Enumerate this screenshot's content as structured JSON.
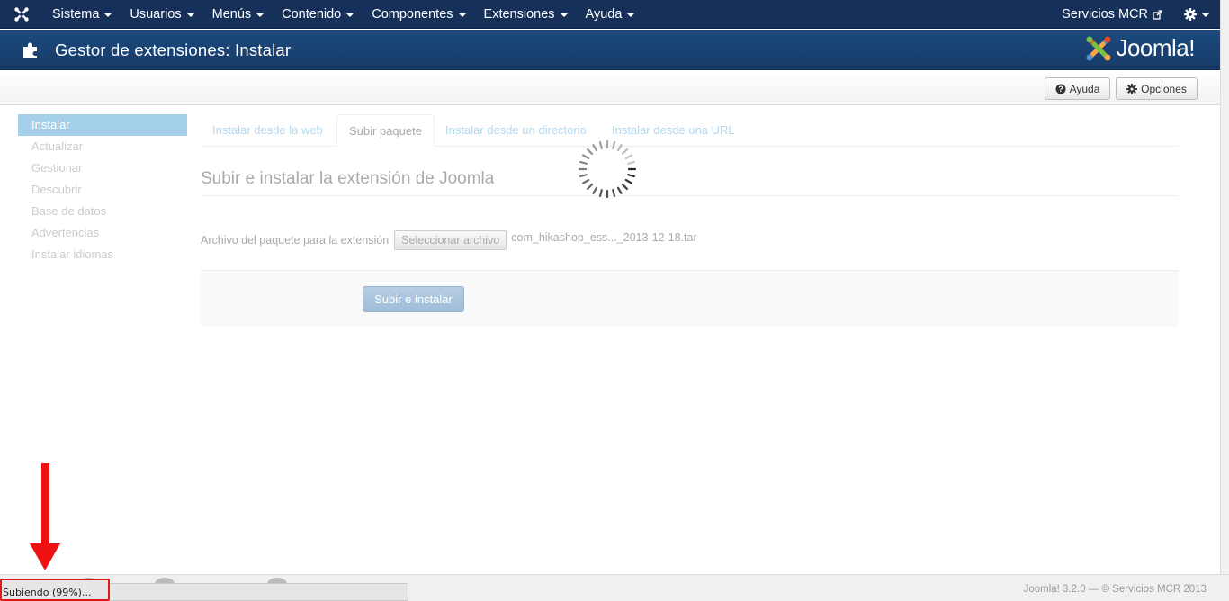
{
  "topnav": {
    "items": [
      {
        "label": "Sistema"
      },
      {
        "label": "Usuarios"
      },
      {
        "label": "Menús"
      },
      {
        "label": "Contenido"
      },
      {
        "label": "Componentes"
      },
      {
        "label": "Extensiones"
      },
      {
        "label": "Ayuda"
      }
    ],
    "site_name": "Servicios MCR"
  },
  "header": {
    "title": "Gestor de extensiones: Instalar",
    "brand": "Joomla!"
  },
  "toolbar": {
    "help_label": "Ayuda",
    "options_label": "Opciones"
  },
  "sidebar": {
    "items": [
      {
        "label": "Instalar",
        "active": true
      },
      {
        "label": "Actualizar"
      },
      {
        "label": "Gestionar"
      },
      {
        "label": "Descubrir"
      },
      {
        "label": "Base de datos"
      },
      {
        "label": "Advertencias"
      },
      {
        "label": "Instalar idiomas"
      }
    ]
  },
  "tabs": [
    {
      "label": "Instalar desde la web"
    },
    {
      "label": "Subir paquete",
      "active": true
    },
    {
      "label": "Instalar desde un directorio"
    },
    {
      "label": "Instalar desde una URL"
    }
  ],
  "upload": {
    "title": "Subir e instalar la extensión de Joomla",
    "field_label": "Archivo del paquete para la extensión",
    "file_button": "Seleccionar archivo",
    "file_name": "com_hikashop_ess..._2013-12-18.tar",
    "submit_label": "Subir e instalar"
  },
  "footer": {
    "text": "Joomla! 3.2.0 — © Servicios MCR 2013"
  },
  "status": {
    "text": "Subiendo (99%)...",
    "progress_percent": 99
  },
  "colors": {
    "navbar": "#17305a",
    "header": "#1c4a7e",
    "active_sidebar": "#a4d0ea",
    "link": "#b2d7ee",
    "annotation": "#ee1111"
  }
}
